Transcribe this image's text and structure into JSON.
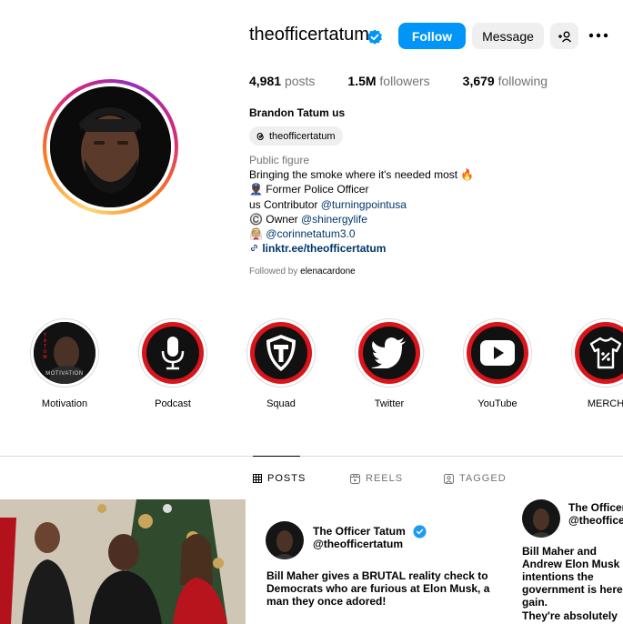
{
  "profile": {
    "username": "theofficertatum",
    "follow_label": "Follow",
    "message_label": "Message",
    "posts_count": "4,981",
    "posts_label": "posts",
    "followers_count": "1.5M",
    "followers_label": "followers",
    "following_count": "3,679",
    "following_label": "following",
    "full_name": "Brandon Tatum us",
    "threads_handle": "theofficertatum",
    "category": "Public figure",
    "bio_line1": "Bringing the smoke where it's needed most 🔥",
    "bio_line2_emoji": "👮🏿‍♂️",
    "bio_line2": "Former Police Officer",
    "bio_line3_prefix": "us Contributor ",
    "bio_line3_link": "@turningpointusa",
    "bio_line4_emoji": "©️",
    "bio_line4_prefix": "Owner ",
    "bio_line4_link": "@shinergylife",
    "bio_line5_emoji": "👰🏼",
    "bio_line5_link": "@corinnetatum3.0",
    "bio_url": "linktr.ee/theofficertatum",
    "followed_prefix": "Followed by ",
    "followed_by": "elenacardone"
  },
  "highlights": [
    {
      "label": "Motivation",
      "icon": "motivation-cover"
    },
    {
      "label": "Podcast",
      "icon": "microphone-icon"
    },
    {
      "label": "Squad",
      "icon": "shield-t-icon"
    },
    {
      "label": "Twitter",
      "icon": "twitter-bird-icon"
    },
    {
      "label": "YouTube",
      "icon": "youtube-play-icon"
    },
    {
      "label": "MERCH",
      "icon": "shirt-tag-icon"
    }
  ],
  "motivation_cover": {
    "side_text": "TATUM",
    "bottom_text": "MOTIVATION"
  },
  "tabs": {
    "posts": "POSTS",
    "reels": "REELS",
    "tagged": "TAGGED"
  },
  "posts": {
    "tweet1": {
      "name": "The Officer Tatum",
      "handle": "@theofficertatum",
      "text": "Bill Maher gives a BRUTAL reality check to Democrats who are furious at Elon Musk, a man they once adored!"
    },
    "tweet2": {
      "name": "The Officer Tatum",
      "handle": "@theofficertatum",
      "text": "Bill Maher and Andrew Elon Musk intentions the government is here gain.",
      "text2": "They're absolutely"
    }
  },
  "colors": {
    "accent": "#0095f6",
    "verified": "#0095f6",
    "link": "#00376b",
    "muted": "#737373",
    "highlight_red": "#d9141b"
  }
}
